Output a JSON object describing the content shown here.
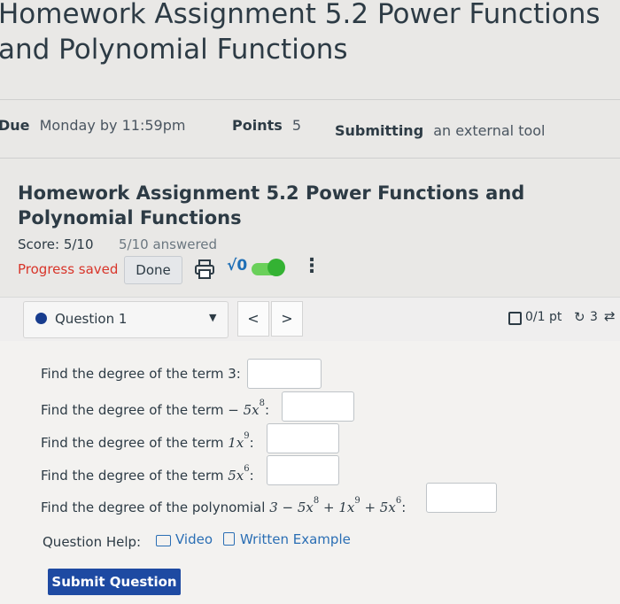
{
  "assignment": {
    "title": "Homework Assignment 5.2 Power Functions and Polynomial Functions",
    "due_label": "Due",
    "due_value": "Monday by 11:59pm",
    "points_label": "Points",
    "points_value": "5",
    "submitting_label": "Submitting",
    "submitting_value": "an external tool"
  },
  "embed": {
    "title": "Homework Assignment 5.2 Power Functions and Polynomial Functions",
    "score": "Score: 5/10",
    "answered": "5/10 answered",
    "progress": "Progress saved",
    "done_label": "Done",
    "sqrt_label": "√0",
    "kebab": "⋮"
  },
  "question": {
    "selector_label": "Question 1",
    "prev": "<",
    "next": ">",
    "points": "0/1 pt",
    "retries": "3",
    "lines": {
      "l1": "Find the degree of the term 3:",
      "l2_text": "Find the degree of the term",
      "l2_math": "− 5x",
      "l2_exp": "8",
      "l3_text": "Find the degree of the term",
      "l3_math": "1x",
      "l3_exp": "9",
      "l4_text": "Find the degree of the term",
      "l4_math": "5x",
      "l4_exp": "6",
      "l5_text": "Find the degree of the polynomial",
      "l5_math_a": "3 − 5x",
      "l5_exp_a": "8",
      "l5_math_b": " + 1x",
      "l5_exp_b": "9",
      "l5_math_c": " + 5x",
      "l5_exp_c": "6",
      "colon": ":"
    },
    "help_label": "Question Help:",
    "video_label": "Video",
    "example_label": "Written Example",
    "submit_label": "Submit Question"
  },
  "colors": {
    "accent_blue": "#1e4aa2",
    "progress_red": "#d8352a",
    "toggle_green": "#34b233"
  }
}
